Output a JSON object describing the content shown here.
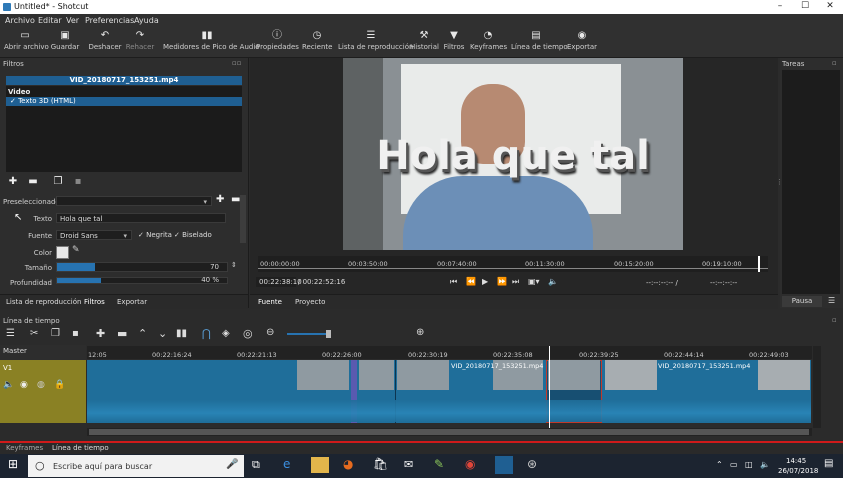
{
  "window": {
    "title": "Untitled* - Shotcut",
    "controls": [
      "–",
      "☐",
      "✕"
    ]
  },
  "menu": [
    "Archivo",
    "Editar",
    "Ver",
    "Preferencias",
    "Ayuda"
  ],
  "toolbar": [
    {
      "icon": "open-icon",
      "label": "Abrir archivo"
    },
    {
      "icon": "save-icon",
      "label": "Guardar"
    },
    {
      "icon": "undo-icon",
      "label": "Deshacer"
    },
    {
      "icon": "redo-icon",
      "label": "Rehacer"
    },
    {
      "icon": "meters-icon",
      "label": "Medidores de Pico de Audio"
    },
    {
      "icon": "properties-icon",
      "label": "Propiedades"
    },
    {
      "icon": "recent-icon",
      "label": "Reciente"
    },
    {
      "icon": "playlist-icon",
      "label": "Lista de reproducción"
    },
    {
      "icon": "history-icon",
      "label": "Historial"
    },
    {
      "icon": "filters-icon",
      "label": "Filtros"
    },
    {
      "icon": "keyframes-icon",
      "label": "Keyframes"
    },
    {
      "icon": "timeline-icon",
      "label": "Línea de tiempo"
    },
    {
      "icon": "export-icon",
      "label": "Exportar"
    }
  ],
  "filters": {
    "header": "Filtros",
    "file": "VID_20180717_153251.mp4",
    "category": "Video",
    "item": "✓ Texto 3D (HTML)",
    "preset_label": "Preseleccionado",
    "text_label": "Texto",
    "text_value": "Hola que tal",
    "font_label": "Fuente",
    "font_value": "Droid Sans",
    "bold_label": "Negrita",
    "bevel_label": "Biselado",
    "color_label": "Color",
    "size_label": "Tamaño",
    "size_value": "70",
    "depth_label": "Profundidad",
    "depth_value": "40 %",
    "tabs": [
      "Lista de reproducción",
      "Filtros",
      "Exportar"
    ]
  },
  "video": {
    "overlay_text": "Hola que tal",
    "ruler": [
      "00:00:00:00",
      "00:03:50:00",
      "00:07:40:00",
      "00:11:30:00",
      "00:15:20:00",
      "00:19:10:00"
    ],
    "current_time": "00:22:38:10",
    "total_time": "/ 00:22:52:16",
    "in_point": "--:--:--:-- /",
    "out_point": "--:--:--:--",
    "tabs": [
      "Fuente",
      "Proyecto"
    ]
  },
  "tasks": {
    "header": "Tareas",
    "pause_label": "Pausa"
  },
  "timeline": {
    "header": "Línea de tiempo",
    "master": "Master",
    "track": "V1",
    "ticks": [
      "12:05",
      "00:22:16:24",
      "00:22:21:13",
      "00:22:26:00",
      "00:22:30:19",
      "00:22:35:08",
      "00:22:39:25",
      "00:22:44:14",
      "00:22:49:03"
    ],
    "clip_name_1": "VID_20180717_153251.mp4",
    "clip_name_2": "VID_20180717_153251.mp4",
    "bottom_tabs": [
      "Keyframes",
      "Línea de tiempo"
    ]
  },
  "taskbar": {
    "search_placeholder": "Escribe aquí para buscar",
    "time": "14:45",
    "date": "26/07/2018"
  },
  "colors": {
    "accent": "#2773b1",
    "track": "#1f6e9a",
    "record_line": "#d01a1a"
  }
}
